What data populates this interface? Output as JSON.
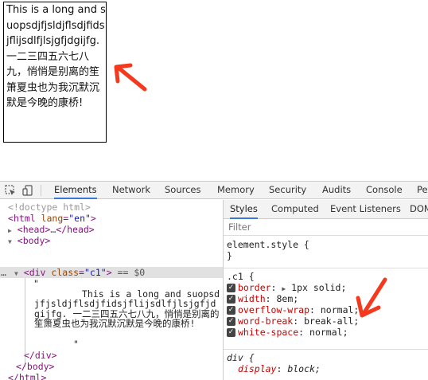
{
  "demo": {
    "text": "This is a long and suopsdjfjsldjflsdjfidsjflijsdlfjlsjgfjdgijfg. 一二三四五六七八九，悄悄是别离的笙箫夏虫也为我沉默沉默是今晚的康桥!"
  },
  "devtools": {
    "tabs": [
      "Elements",
      "Network",
      "Sources",
      "Memory",
      "Security",
      "Audits",
      "Console",
      "Pe"
    ],
    "active_tab": "Elements",
    "dom": {
      "doctype": "<!doctype html>",
      "html_tag": "html",
      "lang_attr": "lang",
      "lang_value": "\"en\"",
      "head_tag": "<head>",
      "head_ellipsis": "…",
      "head_close": "</head>",
      "body_open": "<body>",
      "div_tag": "div",
      "class_attr": "class",
      "class_value": "\"c1\"",
      "selected_marker": "== $0",
      "quote_open": "\"",
      "text_node": "This is a long and suopsdjfjsldjflsdjfidsjflijsdlfjlsjgfjdgijfg. 一二三四五六七八九，悄悄是别离的笙箫夏虫也为我沉默沉默是今晚的康桥!",
      "quote_close": "\"",
      "div_close": "</div>",
      "body_close": "</body>",
      "html_close": "</html>",
      "row_dots": "…"
    },
    "styles": {
      "subtabs": [
        "Styles",
        "Computed",
        "Event Listeners",
        "DOM"
      ],
      "active_subtab": "Styles",
      "filter_placeholder": "Filter",
      "element_style": "element.style {",
      "close_brace": "}",
      "rule_selector": ".c1 {",
      "properties": [
        {
          "name": "border",
          "value": "1px solid;",
          "has_triangle": true,
          "checked": true
        },
        {
          "name": "width",
          "value": "8em;",
          "checked": true
        },
        {
          "name": "overflow-wrap",
          "value": "normal;",
          "checked": true
        },
        {
          "name": "word-break",
          "value": "break-all;",
          "checked": true
        },
        {
          "name": "white-space",
          "value": "normal;",
          "checked": true
        }
      ],
      "ua_selector": "div {",
      "ua_property": {
        "name": "display",
        "value": "block;"
      }
    }
  },
  "colors": {
    "arrow": "#f4391f",
    "tab_underline": "#3879d9",
    "tag": "#881280",
    "attr": "#994500",
    "attr_value": "#1a1aa6",
    "prop_name": "#c80000"
  }
}
